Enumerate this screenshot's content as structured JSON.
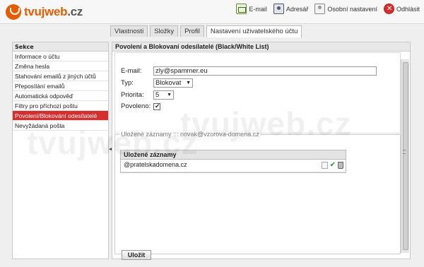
{
  "brand": {
    "logo_text": "tvujweb",
    "logo_tld": ".cz"
  },
  "topnav": [
    {
      "label": "E-mail",
      "icon": "mail-icon"
    },
    {
      "label": "Adresář",
      "icon": "addressbook-icon"
    },
    {
      "label": "Osobní nastavení",
      "icon": "person-icon"
    },
    {
      "label": "Odhlásit",
      "icon": "logout-icon"
    }
  ],
  "tabs": [
    {
      "label": "Vlastnosti"
    },
    {
      "label": "Složky"
    },
    {
      "label": "Profil"
    },
    {
      "label": "Nastavení uživatelského účtu",
      "active": true
    }
  ],
  "sidebar": {
    "title": "Sekce",
    "items": [
      {
        "label": "Informace o účtu"
      },
      {
        "label": "Změna hesla"
      },
      {
        "label": "Stahování emailů z jiných účtů"
      },
      {
        "label": "Přeposílání emailů"
      },
      {
        "label": "Automatická odpověď"
      },
      {
        "label": "Filtry pro příchozí poštu"
      },
      {
        "label": "Povolení/Blokování odesílatelé",
        "active": true
      },
      {
        "label": "Nevyžádaná pošta"
      }
    ]
  },
  "main": {
    "title": "Povolení a Blokovaní odesílatelé (Black/White List)",
    "form": {
      "email_label": "E-mail:",
      "email_value": "zly@spammer.eu",
      "type_label": "Typ:",
      "type_value": "Blokovat",
      "priority_label": "Priorita:",
      "priority_value": "5",
      "enabled_label": "Povoleno:",
      "enabled_checked": true
    },
    "saved": {
      "legend": "Uložené záznamy ::: novak@vzorova-domena.cz",
      "table_header": "Uložené záznamy",
      "rows": [
        {
          "value": "@pratelskadomena.cz"
        }
      ]
    },
    "save_label": "Uložit"
  },
  "watermark": "tvujweb.cz",
  "colors": {
    "brand": "#e65c00",
    "active": "#d32f2f"
  }
}
